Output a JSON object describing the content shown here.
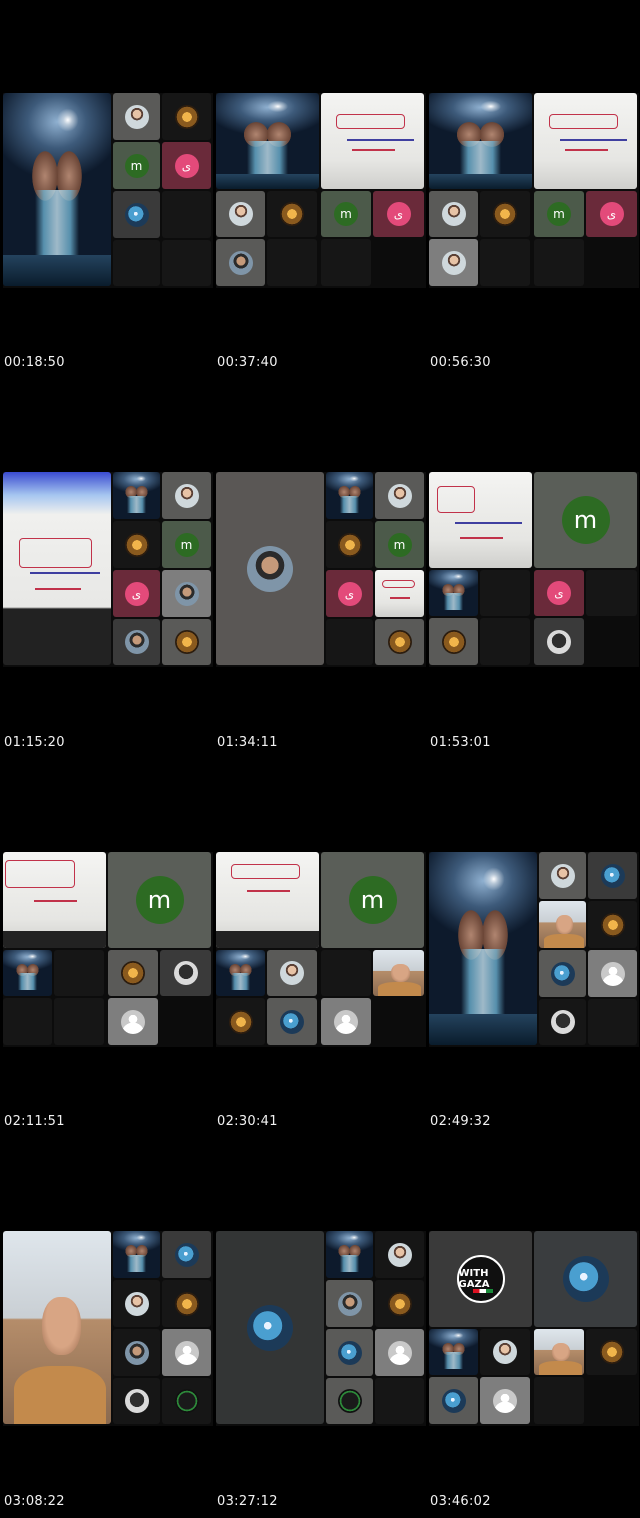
{
  "timestamps": [
    "00:18:50",
    "00:37:40",
    "00:56:30",
    "01:15:20",
    "01:34:11",
    "01:53:01",
    "02:11:51",
    "02:30:41",
    "02:49:32",
    "03:08:22",
    "03:27:12",
    "03:46:02"
  ],
  "letters": {
    "m": "m",
    "s": "ى"
  },
  "badge_text": "WITH GAZA",
  "icons": {
    "participant": "avatar-icon",
    "placeholder": "person-placeholder-icon"
  },
  "colors": {
    "background": "#000000",
    "green_avatar": "#2d6b23",
    "pink_avatar": "#e34a7a"
  }
}
